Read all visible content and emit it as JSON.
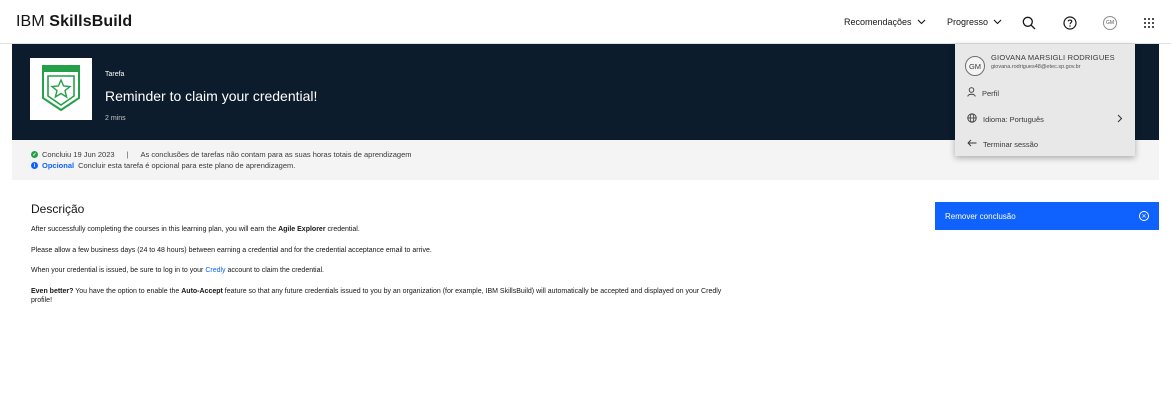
{
  "header": {
    "brand_light": "IBM ",
    "brand_bold": "SkillsBuild",
    "nav": {
      "recommendations": "Recomendações",
      "progress": "Progresso"
    },
    "avatar_initials": "GM",
    "icons": [
      "search-icon",
      "help-icon",
      "avatar-icon",
      "app-switcher-icon"
    ]
  },
  "hero": {
    "type_label": "Tarefa",
    "title": "Reminder to claim your credential!",
    "duration": "2 mins"
  },
  "status": {
    "completed_text": "Concluiu 19 Jun 2023",
    "separator": "|",
    "hours_note": "As conclusões de tarefas não contam para as suas horas totais de aprendizagem",
    "optional_label": "Opcional",
    "optional_note": "Concluir esta tarefa é opcional para este plano de aprendizagem."
  },
  "description": {
    "heading": "Descrição",
    "p1_pre": "After successfully completing the courses in this learning plan, you will earn the ",
    "p1_bold": "Agile Explorer",
    "p1_post": " credential.",
    "p2": "Please allow a few business days (24 to 48 hours) between earning a credential and for the credential acceptance email to arrive.",
    "p3_pre": "When your credential is issued, be sure to log in to your ",
    "p3_link": "Credly",
    "p3_post": " account to claim the credential.",
    "p4_bold1": "Even better?",
    "p4_mid1": " You have the option to enable the ",
    "p4_bold2": "Auto-Accept",
    "p4_post": " feature so that any future credentials issued to you by an organization (for example, IBM SkillsBuild) will automatically be accepted and displayed on your Credly profile!"
  },
  "actions": {
    "remove_completion": "Remover conclusão"
  },
  "user_menu": {
    "initials": "GM",
    "name": "GIOVANA MARSIGLI RODRIGUES",
    "email": "giovana.rodrigues48@etec.sp.gov.br",
    "profile": "Perfil",
    "language": "Idioma: Português",
    "logout": "Terminar sessão"
  },
  "colors": {
    "hero_bg": "#0c1c2c",
    "accent": "#0f62fe",
    "success": "#24a148",
    "badge_green": "#24a148"
  }
}
